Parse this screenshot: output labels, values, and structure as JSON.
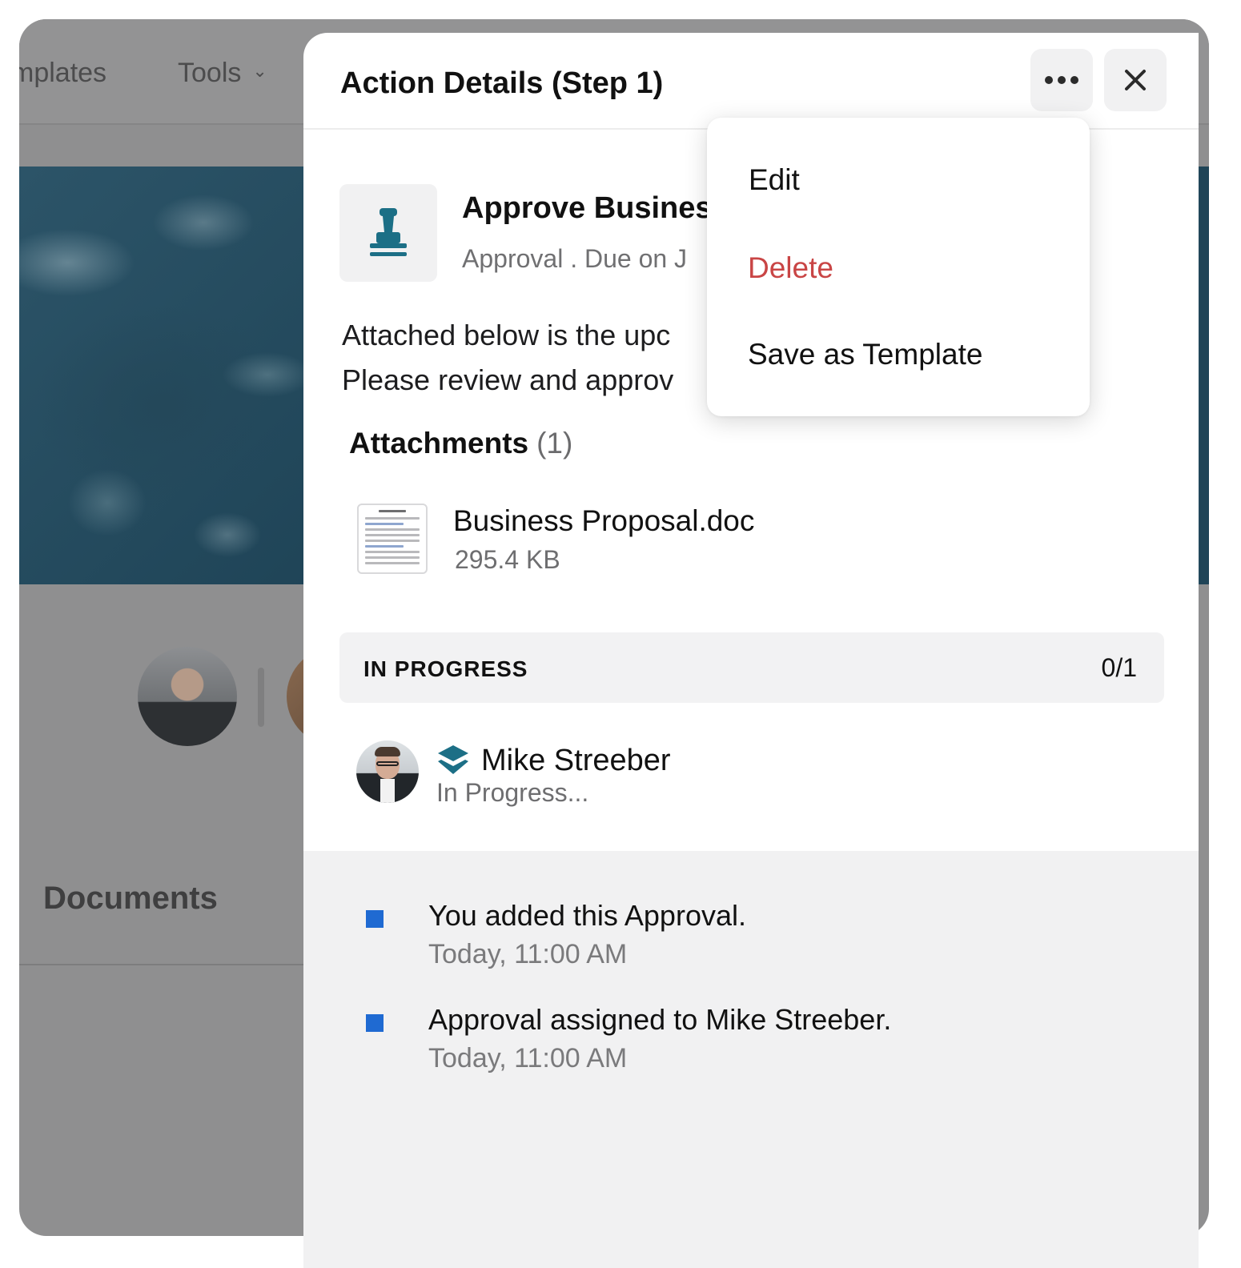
{
  "background": {
    "nav": {
      "templates_label": "mplates",
      "tools_label": "Tools"
    },
    "documents_title": "Documents"
  },
  "panel": {
    "title": "Action Details (Step 1)",
    "action": {
      "title": "Approve Busines",
      "subtitle": "Approval . Due on J"
    },
    "description": {
      "line1": "Attached below is the upc",
      "line2": "Please review and approv"
    },
    "attachments": {
      "heading": "Attachments",
      "count": "(1)",
      "files": [
        {
          "name": "Business Proposal.doc",
          "size": "295.4 KB"
        }
      ]
    },
    "progress": {
      "label": "IN PROGRESS",
      "count": "0/1"
    },
    "assignee": {
      "name": "Mike Streeber",
      "status": "In Progress..."
    },
    "activity": [
      {
        "text": "You added this Approval.",
        "time": "Today, 11:00 AM"
      },
      {
        "text": "Approval assigned to Mike Streeber.",
        "time": "Today, 11:00 AM"
      }
    ]
  },
  "menu": {
    "edit": "Edit",
    "delete": "Delete",
    "save_as_template": "Save as Template"
  },
  "colors": {
    "accent_teal": "#1c6f86",
    "danger": "#c94545",
    "activity_bullet": "#1f6ad2"
  },
  "icons": {
    "more": "more-horizontal-icon",
    "close": "close-icon",
    "action": "stamp-icon",
    "assignee_badge": "layers-icon",
    "nav_dropdown": "chevron-down-icon"
  }
}
